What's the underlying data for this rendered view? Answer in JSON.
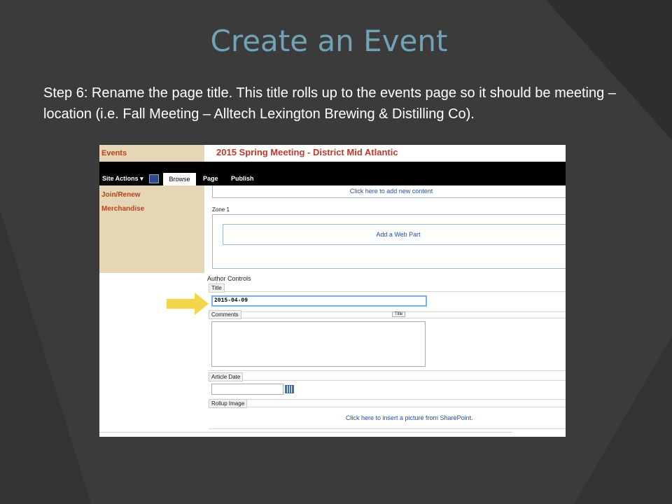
{
  "slide": {
    "title": "Create an Event",
    "step_text": "Step 6: Rename the page title. This title rolls up to the events page so it should be meeting – location (i.e. Fall Meeting – Alltech Lexington Brewing & Distilling Co)."
  },
  "colors": {
    "background": "#3b3b3b",
    "title": "#6fa3b5",
    "arrow": "#f2d64a",
    "nav_bg": "#e6d6b5",
    "nav_text": "#b8411f"
  },
  "screenshot": {
    "events_link": "Events",
    "page_heading": "2015 Spring Meeting - District Mid Atlantic",
    "ribbon": {
      "site_actions": "Site Actions ▾",
      "browse": "Browse",
      "page": "Page",
      "publish": "Publish"
    },
    "nav": {
      "join_renew": "Join/Renew",
      "merchandise": "Merchandise"
    },
    "add_content": "Click here to add new content",
    "zone_label": "Zone 1",
    "add_web_part": "Add a Web Part",
    "author_controls": "Author Controls",
    "fields": {
      "title_label": "Title",
      "title_value": "2015-04-09",
      "comments_label": "Comments",
      "title_button": "Title",
      "article_date_label": "Article Date",
      "rollup_image_label": "Rollup Image",
      "insert_picture": "Click here to insert a picture from SharePoint."
    }
  }
}
